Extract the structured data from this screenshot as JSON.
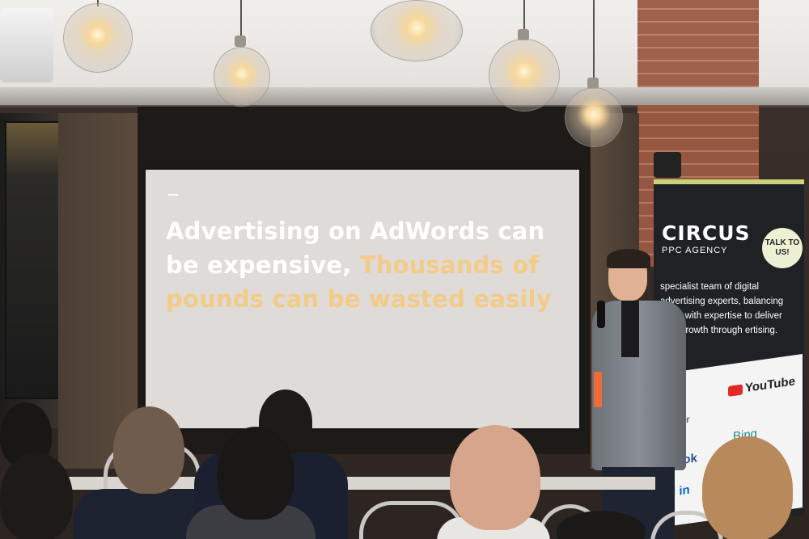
{
  "slide": {
    "line_white": "Advertising on AdWords can be expensive,",
    "line_accent": "Thousands of pounds can be wasted easily"
  },
  "banner": {
    "brand": "CIRCUS",
    "subtitle": "PPC AGENCY",
    "badge": "TALK TO US!",
    "body": "specialist team of digital advertising experts, balancing bition with expertise to deliver able growth through ertising.",
    "logos": {
      "youtube": "YouTube",
      "partner": "tner",
      "bing": "Bing",
      "facebook": "book",
      "linkedin": "d in"
    }
  },
  "colors": {
    "slide_background": "#dedbd8",
    "slide_accent": "#f4cb87",
    "banner_background": "#1f2124",
    "banner_stripe": "#c9d27b"
  }
}
